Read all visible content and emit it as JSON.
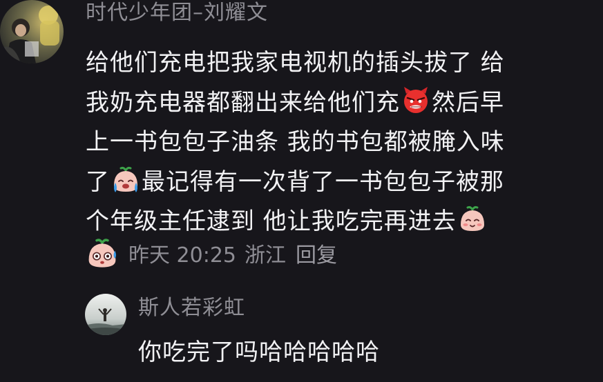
{
  "comment": {
    "author": "时代少年团–刘耀文",
    "lines": [
      {
        "a": "给他们充电把我家电视机的插头拔了  给"
      },
      {
        "a": "我奶充电器都翻出来给他们充",
        "emoji": "angry-devil-emoji",
        "b": "然后早"
      },
      {
        "a": "上一书包包子油条  我的书包都被腌入味"
      },
      {
        "a": "了",
        "emoji": "crying-bun-emoji",
        "b": "最记得有一次背了一书包包子被那"
      },
      {
        "a": "个年级主任逮到  他让我吃完再进去",
        "emoji": "smiling-bun-emoji",
        "b": ""
      }
    ],
    "meta": {
      "emoji": "sweating-bun-emoji",
      "time": "昨天 20:25",
      "region": "浙江",
      "reply_label": "回复"
    }
  },
  "reply": {
    "author": "斯人若彩虹",
    "text": "你吃完了吗哈哈哈哈哈"
  },
  "colors": {
    "background": "#17161b",
    "text_primary": "#f2f2f4",
    "text_secondary": "#8f8e95"
  }
}
